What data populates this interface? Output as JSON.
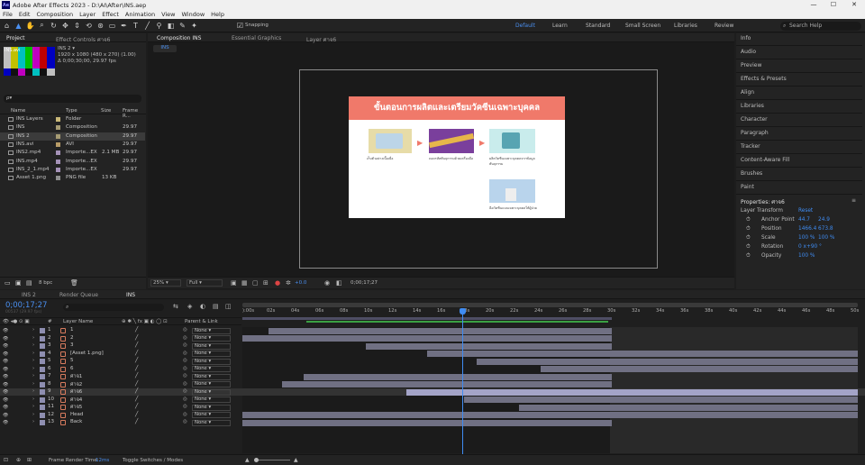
{
  "titlebar": {
    "app": "Adobe After Effects 2023 - D:\\AI\\After\\INS.aep",
    "min": "—",
    "max": "☐",
    "close": "✕"
  },
  "menu": [
    "File",
    "Edit",
    "Composition",
    "Layer",
    "Effect",
    "Animation",
    "View",
    "Window",
    "Help"
  ],
  "toolbar": {
    "snapping": "Snapping",
    "workspaces": [
      "Default",
      "Learn",
      "Standard",
      "Small Screen",
      "Libraries",
      "Review"
    ],
    "search_help": "Search Help"
  },
  "project_panel": {
    "tab_project": "Project",
    "tab_effect_controls": "Effect Controls ศาจ6",
    "item_name": "INS 2 ▾",
    "info_line1": "1920 x 1080  (480 x 270) (1.00)",
    "info_line2": "Δ 0;00;30;00, 29.97 fps",
    "search_placeholder": "ρ▾",
    "columns": [
      "Name",
      "Type",
      "Size",
      "Frame R..."
    ],
    "items": [
      {
        "name": "INS Layers",
        "type": "Folder",
        "size": "",
        "fr": "",
        "color": "#c9b878"
      },
      {
        "name": "INS",
        "type": "Composition",
        "size": "",
        "fr": "29.97",
        "color": "#a79c74"
      },
      {
        "name": "INS 2",
        "type": "Composition",
        "size": "",
        "fr": "29.97",
        "color": "#a79c74"
      },
      {
        "name": "INS.avi",
        "type": "AVI",
        "size": "",
        "fr": "29.97",
        "color": "#b89c67"
      },
      {
        "name": "INS2.mp4",
        "type": "Importe...EX",
        "size": "2.1 MB",
        "fr": "29.97",
        "color": "#a592b8"
      },
      {
        "name": "INS.mp4",
        "type": "Importe...EX",
        "size": "",
        "fr": "29.97",
        "color": "#a592b8"
      },
      {
        "name": "INS_2_1.mp4",
        "type": "Importe...EX",
        "size": "",
        "fr": "29.97",
        "color": "#a592b8"
      },
      {
        "name": "Asset 1.png",
        "type": "PNG file",
        "size": "13 KB",
        "fr": "",
        "color": "#8f8f8f"
      }
    ],
    "bpc": "8 bpc"
  },
  "comp_panel": {
    "tab_comp": "Composition INS",
    "tab_essential": "Essential Graphics",
    "tab_layer": "Layer ศาจ6",
    "breadcrumb": "INS",
    "slide_title": "ขั้นตอนการผลิตและเตรียมวัคซีนเฉพาะบุคคล",
    "step1": "เก็บตัวอย่างเนื้อเยื่อ",
    "step2": "ถอดรหัสพันธุกรรมด้วยเครื่องมือ",
    "step3": "ผลิตวัคซีนเฉพาะบุคคลจากข้อมูลพันธุกรรม",
    "step4": "ฉีดวัคซีนแบบเฉพาะบุคคลให้ผู้ป่วย",
    "zoom": "25%",
    "resolution": "Full",
    "timecode": "0;00;17;27",
    "exposure": "+0.0"
  },
  "right_panel": {
    "items": [
      "Info",
      "Audio",
      "Preview",
      "Effects & Presets",
      "Align",
      "Libraries",
      "Character",
      "Paragraph",
      "Tracker",
      "Content-Aware Fill",
      "Brushes",
      "Paint"
    ],
    "properties_title": "Properties: ศาจ6",
    "layer_transform": "Layer Transform",
    "reset": "Reset",
    "props": [
      {
        "label": "Anchor Point",
        "v1": "44.7",
        "v2": "24.9"
      },
      {
        "label": "Position",
        "v1": "1466.4",
        "v2": "673.8"
      },
      {
        "label": "Scale",
        "v1": "100 %",
        "v2": "100 %"
      },
      {
        "label": "Rotation",
        "v1": "0 x+90 °",
        "v2": ""
      },
      {
        "label": "Opacity",
        "v1": "100 %",
        "v2": ""
      }
    ]
  },
  "timeline": {
    "tabs": [
      "INS 2",
      "Render Queue",
      "INS"
    ],
    "timecode": "0;00;17;27",
    "timecode_sub": "00537 (29.97 fps)",
    "col_layer_name": "Layer Name",
    "col_parent": "Parent & Link",
    "ruler": [
      "):00s",
      "02s",
      "04s",
      "06s",
      "08s",
      "10s",
      "12s",
      "14s",
      "16s",
      "18s",
      "20s",
      "22s",
      "24s",
      "26s",
      "28s",
      "30s",
      "32s",
      "34s",
      "36s",
      "38s",
      "40s",
      "42s",
      "44s",
      "46s",
      "48s",
      "50s"
    ],
    "layers": [
      {
        "num": "1",
        "name": "1",
        "parent": "None",
        "label": "#8e8eb0",
        "start": 0.043,
        "end": 0.6,
        "sel": false
      },
      {
        "num": "2",
        "name": "2",
        "parent": "None",
        "label": "#8e8eb0",
        "start": 0.0,
        "end": 0.6,
        "sel": false
      },
      {
        "num": "3",
        "name": "3",
        "parent": "None",
        "label": "#8e8eb0",
        "start": 0.2,
        "end": 0.6,
        "sel": false
      },
      {
        "num": "4",
        "name": "[Asset 1.png]",
        "parent": "None",
        "label": "#8e8eb0",
        "start": 0.3,
        "end": 1.0,
        "sel": false
      },
      {
        "num": "5",
        "name": "5",
        "parent": "None",
        "label": "#8e8eb0",
        "start": 0.38,
        "end": 1.0,
        "sel": false
      },
      {
        "num": "6",
        "name": "6",
        "parent": "None",
        "label": "#8e8eb0",
        "start": 0.485,
        "end": 1.0,
        "sel": false
      },
      {
        "num": "7",
        "name": "ศาจ1",
        "parent": "None",
        "label": "#8e8eb0",
        "start": 0.1,
        "end": 0.6,
        "sel": false
      },
      {
        "num": "8",
        "name": "ศาจ2",
        "parent": "None",
        "label": "#8e8eb0",
        "start": 0.065,
        "end": 0.6,
        "sel": false
      },
      {
        "num": "9",
        "name": "ศาจ6",
        "parent": "None",
        "label": "#8e8eb0",
        "start": 0.267,
        "end": 1.0,
        "sel": true
      },
      {
        "num": "10",
        "name": "ศาจ4",
        "parent": "None",
        "label": "#8e8eb0",
        "start": 0.36,
        "end": 1.0,
        "sel": false
      },
      {
        "num": "11",
        "name": "ศาจ5",
        "parent": "None",
        "label": "#8e8eb0",
        "start": 0.45,
        "end": 1.0,
        "sel": false
      },
      {
        "num": "12",
        "name": "Head",
        "parent": "None",
        "label": "#8e8eb0",
        "start": 0.0,
        "end": 1.0,
        "sel": false
      },
      {
        "num": "13",
        "name": "Back",
        "parent": "None",
        "label": "#8e8eb0",
        "start": 0.0,
        "end": 0.6,
        "sel": false
      }
    ],
    "playhead_fraction": 0.358,
    "work_area_end_fraction": 0.6,
    "frame_render": "Frame Render Time:",
    "frame_render_value": "12ms",
    "toggle_modes": "Toggle Switches / Modes"
  }
}
